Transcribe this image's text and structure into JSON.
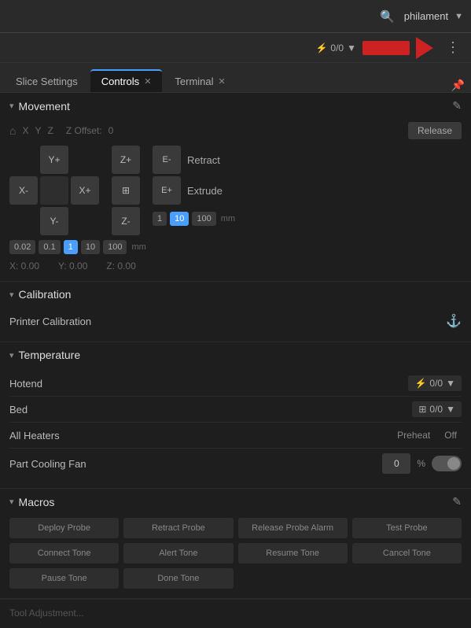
{
  "topbar": {
    "search_icon": "🔍",
    "user": "philament",
    "dropdown_arrow": "▼"
  },
  "secondbar": {
    "print_status": "0/0",
    "dots": "⋮"
  },
  "tabs": [
    {
      "label": "Slice Settings",
      "active": false,
      "closeable": false
    },
    {
      "label": "Controls",
      "active": true,
      "closeable": true
    },
    {
      "label": "Terminal",
      "active": false,
      "closeable": true
    }
  ],
  "pin_label": "📌",
  "sections": {
    "movement": {
      "title": "Movement",
      "home_label": "⌂",
      "axes": [
        "X",
        "Y",
        "Z"
      ],
      "z_offset_label": "Z Offset:",
      "z_offset_value": "0",
      "release_label": "Release",
      "y_plus": "Y+",
      "y_minus": "Y-",
      "x_minus": "X-",
      "x_plus": "X+",
      "z_plus": "Z+",
      "z_minus": "Z-",
      "e_minus": "E-",
      "e_plus": "E+",
      "retract_label": "Retract",
      "extrude_label": "Extrude",
      "xy_steps": [
        "0.02",
        "0.1",
        "1",
        "10",
        "100"
      ],
      "xy_active_step": "1",
      "e_steps": [
        "1",
        "10",
        "100"
      ],
      "e_active_step": "10",
      "unit": "mm",
      "coord_x": "X: 0.00",
      "coord_y": "Y: 0.00",
      "coord_z": "Z: 0.00"
    },
    "calibration": {
      "title": "Calibration",
      "item_label": "Printer Calibration",
      "nav_icon": "⚓"
    },
    "temperature": {
      "title": "Temperature",
      "hotend_label": "Hotend",
      "hotend_value": "0/0",
      "bed_label": "Bed",
      "bed_value": "0/0",
      "all_heaters_label": "All Heaters",
      "preheat_label": "Preheat",
      "off_label": "Off",
      "part_cooling_label": "Part Cooling Fan",
      "fan_value": "0",
      "fan_unit": "%"
    },
    "macros": {
      "title": "Macros",
      "buttons": [
        "Deploy Probe",
        "Retract Probe",
        "Release Probe Alarm",
        "Test Probe",
        "Connect Tone",
        "Alert Tone",
        "Resume Tone",
        "Cancel Tone",
        "Pause Tone",
        "Done Tone"
      ]
    }
  },
  "bottom_hint": "Tool Adjustment..."
}
